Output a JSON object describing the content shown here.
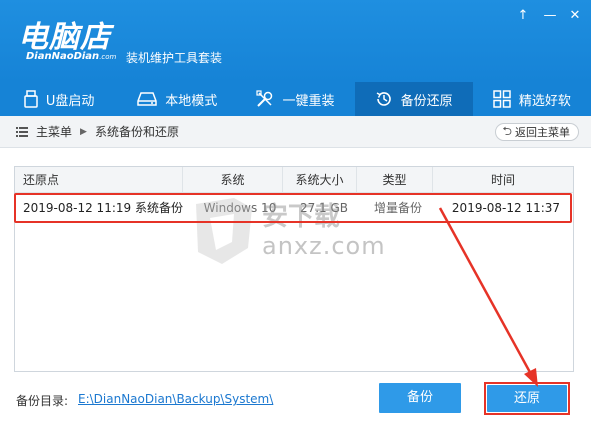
{
  "app": {
    "logo_cn": "电脑店",
    "logo_en": "DianNaoDian",
    "logo_en_suffix": ".com",
    "subtitle": "装机维护工具套装",
    "window_controls": [
      "↑",
      "—",
      "✕"
    ]
  },
  "nav": {
    "items": [
      {
        "label": "U盘启动",
        "icon": "usb-icon"
      },
      {
        "label": "本地模式",
        "icon": "hard-drive-icon"
      },
      {
        "label": "一键重装",
        "icon": "tools-icon"
      },
      {
        "label": "备份还原",
        "icon": "history-icon",
        "active": true
      },
      {
        "label": "精选好软",
        "icon": "apps-grid-icon"
      }
    ]
  },
  "breadcrumb": {
    "root": "主菜单",
    "current": "系统备份和还原",
    "back_label": "返回主菜单"
  },
  "table": {
    "columns": [
      "还原点",
      "系统",
      "系统大小",
      "类型",
      "时间"
    ],
    "rows": [
      {
        "point": "2019-08-12 11:19 系统备份",
        "system": "Windows 10",
        "size": "27.1 GB",
        "type": "增量备份",
        "time": "2019-08-12 11:37"
      }
    ]
  },
  "watermark": {
    "text_cn": "安下载",
    "text_en": "anxz.com"
  },
  "footer": {
    "dir_label": "备份目录:",
    "dir_path": "E:\\DianNaoDian\\Backup\\System\\",
    "backup_label": "备份",
    "restore_label": "还原"
  },
  "colors": {
    "header_blue": "#1683d6",
    "active_tab": "#0f6cb8",
    "button_blue": "#2f9ae8",
    "annotation_red": "#e63327",
    "link_blue": "#1b78d0"
  }
}
